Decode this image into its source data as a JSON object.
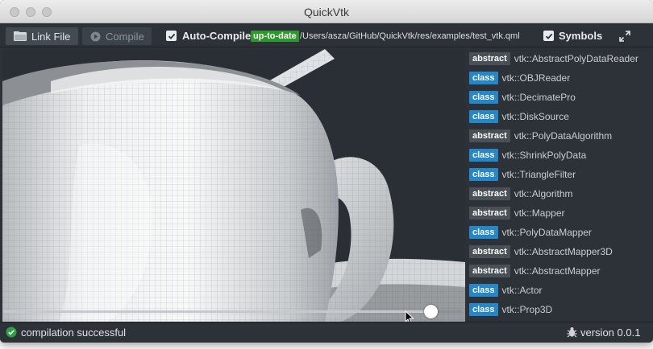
{
  "window": {
    "title": "QuickVtk"
  },
  "toolbar": {
    "link_label": "Link File",
    "compile_label": "Compile",
    "auto_compile_label": "Auto-Compile",
    "auto_compile_checked": true,
    "status_badge": "up-to-date",
    "file_path": "/Users/asza/GitHub/QuickVtk/res/examples/test_vtk.qml",
    "symbols_label": "Symbols",
    "symbols_checked": true
  },
  "viewport": {
    "slider_value": 0.93
  },
  "symbols": {
    "items": [
      {
        "kind": "abstract",
        "name": "vtk::AbstractPolyDataReader"
      },
      {
        "kind": "class",
        "name": "vtk::OBJReader"
      },
      {
        "kind": "class",
        "name": "vtk::DecimatePro"
      },
      {
        "kind": "class",
        "name": "vtk::DiskSource"
      },
      {
        "kind": "abstract",
        "name": "vtk::PolyDataAlgorithm"
      },
      {
        "kind": "class",
        "name": "vtk::ShrinkPolyData"
      },
      {
        "kind": "class",
        "name": "vtk::TriangleFilter"
      },
      {
        "kind": "abstract",
        "name": "vtk::Algorithm"
      },
      {
        "kind": "abstract",
        "name": "vtk::Mapper"
      },
      {
        "kind": "class",
        "name": "vtk::PolyDataMapper"
      },
      {
        "kind": "abstract",
        "name": "vtk::AbstractMapper3D"
      },
      {
        "kind": "abstract",
        "name": "vtk::AbstractMapper"
      },
      {
        "kind": "class",
        "name": "vtk::Actor"
      },
      {
        "kind": "class",
        "name": "vtk::Prop3D"
      }
    ]
  },
  "status": {
    "message": "compilation successful",
    "version": "version 0.0.1"
  },
  "colors": {
    "class_badge": "#2487c9",
    "abstract_badge": "#4a5058",
    "success_badge": "#2c9a2a",
    "background": "#2d3238"
  },
  "icons": {
    "link": "link-icon",
    "compile": "play-icon",
    "expand": "expand-icon",
    "status": "check-circle-icon",
    "version": "bug-icon"
  }
}
